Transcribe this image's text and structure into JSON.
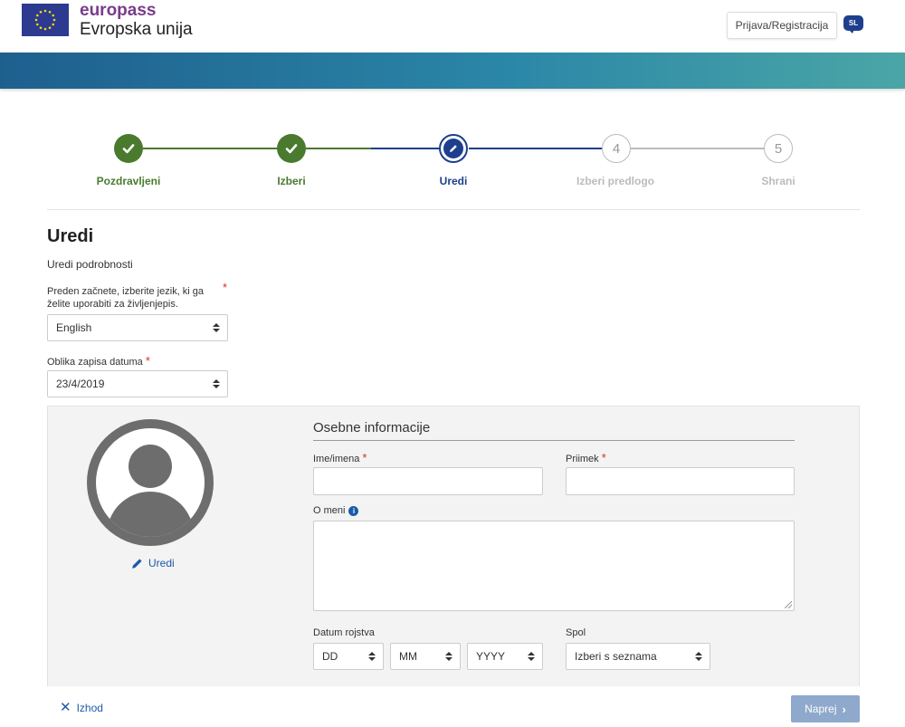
{
  "header": {
    "brand_name": "europass",
    "brand_subtitle": "Evropska unija",
    "login_label": "Prijava/Registracija",
    "language_code": "SL"
  },
  "stepper": {
    "steps": [
      {
        "number": "1",
        "label": "Pozdravljeni",
        "state": "done"
      },
      {
        "number": "2",
        "label": "Izberi",
        "state": "done"
      },
      {
        "number": "3",
        "label": "Uredi",
        "state": "current"
      },
      {
        "number": "4",
        "label": "Izberi predlogo",
        "state": "todo"
      },
      {
        "number": "5",
        "label": "Shrani",
        "state": "todo"
      }
    ]
  },
  "main": {
    "title": "Uredi",
    "subtitle": "Uredi podrobnosti",
    "language_prompt": "Preden začnete, izberite jezik, ki ga želite uporabiti za življenjepis.",
    "language_value": "English",
    "date_format_label": "Oblika zapisa datuma",
    "date_format_value": "23/4/2019",
    "required_mark": "*"
  },
  "personal": {
    "edit_photo_label": "Uredi",
    "section_title": "Osebne informacije",
    "first_name_label": "Ime/imena",
    "first_name_value": "",
    "last_name_label": "Priimek",
    "last_name_value": "",
    "about_label": "O meni",
    "about_value": "",
    "birth_label": "Datum rojstva",
    "day_value": "DD",
    "month_value": "MM",
    "year_value": "YYYY",
    "gender_label": "Spol",
    "gender_value": "Izberi s seznama"
  },
  "footer": {
    "exit_label": "Izhod",
    "next_label": "Naprej"
  },
  "colors": {
    "brand_purple": "#7a3b8c",
    "done_green": "#4a7a2e",
    "current_blue": "#1d3f8d",
    "link_blue": "#1d5aa8",
    "next_button": "#8fa9cc"
  }
}
